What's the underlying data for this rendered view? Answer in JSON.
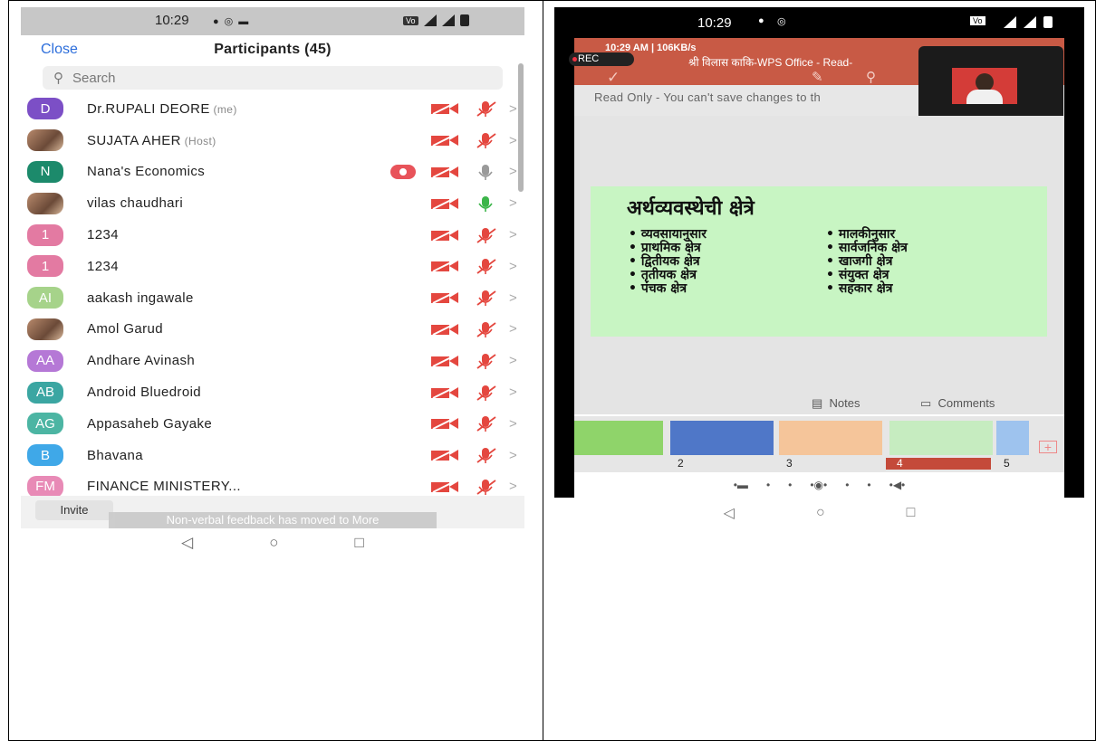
{
  "left": {
    "status": {
      "time": "10:29"
    },
    "header": {
      "close": "Close",
      "title": "Participants (45)"
    },
    "search": {
      "placeholder": "Search"
    },
    "participants": [
      {
        "initials": "D",
        "name": "Dr.RUPALI DEORE",
        "tag": "(me)",
        "color": "#7c4fc6",
        "mic": "muted",
        "recording": false,
        "photo": false
      },
      {
        "initials": "",
        "name": "SUJATA AHER",
        "tag": "(Host)",
        "color": "#8a6b55",
        "mic": "muted",
        "recording": false,
        "photo": true
      },
      {
        "initials": "N",
        "name": "Nana's Economics",
        "tag": "",
        "color": "#1c8a6b",
        "mic": "grey",
        "recording": true,
        "photo": false
      },
      {
        "initials": "",
        "name": "vilas chaudhari",
        "tag": "",
        "color": "#c93a33",
        "mic": "active",
        "recording": false,
        "photo": true
      },
      {
        "initials": "1",
        "name": "1234",
        "tag": "",
        "color": "#e37aa2",
        "mic": "muted",
        "recording": false,
        "photo": false
      },
      {
        "initials": "1",
        "name": "1234",
        "tag": "",
        "color": "#e37aa2",
        "mic": "muted",
        "recording": false,
        "photo": false
      },
      {
        "initials": "AI",
        "name": "aakash ingawale",
        "tag": "",
        "color": "#a6d38a",
        "mic": "muted",
        "recording": false,
        "photo": false
      },
      {
        "initials": "",
        "name": "Amol Garud",
        "tag": "",
        "color": "#8a5a4a",
        "mic": "muted",
        "recording": false,
        "photo": true
      },
      {
        "initials": "AA",
        "name": "Andhare Avinash",
        "tag": "",
        "color": "#b578d6",
        "mic": "muted",
        "recording": false,
        "photo": false
      },
      {
        "initials": "AB",
        "name": "Android Bluedroid",
        "tag": "",
        "color": "#3ba6a2",
        "mic": "muted",
        "recording": false,
        "photo": false
      },
      {
        "initials": "AG",
        "name": "Appasaheb Gayake",
        "tag": "",
        "color": "#4cb5a3",
        "mic": "muted",
        "recording": false,
        "photo": false
      },
      {
        "initials": "B",
        "name": "Bhavana",
        "tag": "",
        "color": "#3fa8e8",
        "mic": "muted",
        "recording": false,
        "photo": false
      },
      {
        "initials": "FM",
        "name": "FINANCE MINISTERY...",
        "tag": "",
        "color": "#e88ab6",
        "mic": "muted",
        "recording": false,
        "photo": false
      }
    ],
    "footer": {
      "invite": "Invite",
      "toast": "Non-verbal feedback has moved to More"
    }
  },
  "right": {
    "status": {
      "time": "10:29"
    },
    "wps": {
      "stat": "10:29 AM | 106KB/s",
      "title": "श्री विलास काकि-WPS Office - Read-"
    },
    "rec": "REC",
    "readonly": "Read Only - You can't save changes to th",
    "slide": {
      "title": "अर्थव्यवस्थेची क्षेत्रे",
      "left_bullets": [
        "• व्यवसायानुसार",
        "• प्राथमिक क्षेत्र",
        "• द्वितीयक क्षेत्र",
        "• तृतीयक क्षेत्र",
        "• पंचक क्षेत्र"
      ],
      "right_bullets": [
        "• मालकीनुसार",
        "• सार्वजनिक क्षेत्र",
        "• खाजगी क्षेत्र",
        "• संयुक्त क्षेत्र",
        "• सहकार क्षेत्र"
      ]
    },
    "notes": "Notes",
    "comments": "Comments",
    "thumbs": [
      {
        "num": "",
        "color": "#8fd46a"
      },
      {
        "num": "2",
        "color": "#4f77c8"
      },
      {
        "num": "3",
        "color": "#f5c59a"
      },
      {
        "num": "4",
        "color": "#c6ecc0"
      },
      {
        "num": "5",
        "color": "#9ec3ee"
      }
    ]
  }
}
